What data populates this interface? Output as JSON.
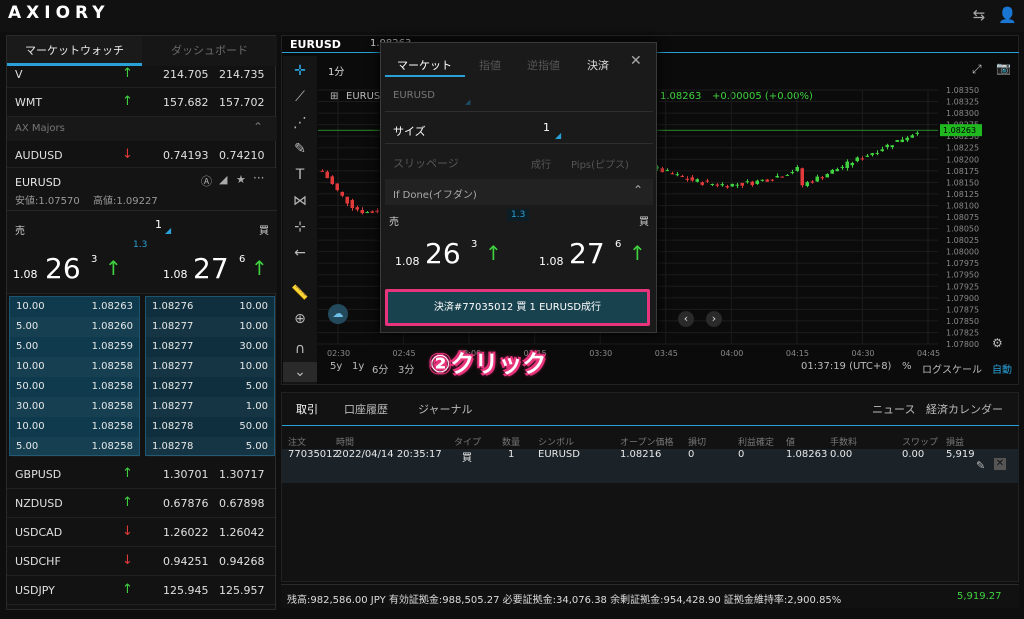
{
  "app": {
    "logo": "AXIORY"
  },
  "left": {
    "tabs": [
      "マーケットウォッチ",
      "ダッシュボード"
    ],
    "rows_top": [
      {
        "sym": "V",
        "bid": "214.705",
        "ask": "214.735",
        "dir": "up"
      },
      {
        "sym": "WMT",
        "bid": "157.682",
        "ask": "157.702",
        "dir": "up"
      }
    ],
    "section": "AX Majors",
    "audusd": {
      "sym": "AUDUSD",
      "bid": "0.74193",
      "ask": "0.74210",
      "dir": "down"
    },
    "eurusd": {
      "sym": "EURUSD",
      "low": "安値:1.07570",
      "high": "高値:1.09227",
      "sell_label": "売",
      "buy_label": "買",
      "qty": "1",
      "spread": "1.3",
      "sell_prefix": "1.08",
      "sell_big": "26",
      "sell_sup": "3",
      "buy_prefix": "1.08",
      "buy_big": "27",
      "buy_sup": "6"
    },
    "depth_sell": [
      [
        "10.00",
        "1.08263"
      ],
      [
        "5.00",
        "1.08260"
      ],
      [
        "5.00",
        "1.08259"
      ],
      [
        "10.00",
        "1.08258"
      ],
      [
        "50.00",
        "1.08258"
      ],
      [
        "30.00",
        "1.08258"
      ],
      [
        "10.00",
        "1.08258"
      ],
      [
        "5.00",
        "1.08258"
      ]
    ],
    "depth_buy": [
      [
        "1.08276",
        "10.00"
      ],
      [
        "1.08277",
        "10.00"
      ],
      [
        "1.08277",
        "30.00"
      ],
      [
        "1.08277",
        "10.00"
      ],
      [
        "1.08277",
        "5.00"
      ],
      [
        "1.08277",
        "1.00"
      ],
      [
        "1.08278",
        "50.00"
      ],
      [
        "1.08278",
        "5.00"
      ]
    ],
    "rows_bottom": [
      {
        "sym": "GBPUSD",
        "bid": "1.30701",
        "ask": "1.30717",
        "dir": "up"
      },
      {
        "sym": "NZDUSD",
        "bid": "0.67876",
        "ask": "0.67898",
        "dir": "up"
      },
      {
        "sym": "USDCAD",
        "bid": "1.26022",
        "ask": "1.26042",
        "dir": "down"
      },
      {
        "sym": "USDCHF",
        "bid": "0.94251",
        "ask": "0.94268",
        "dir": "down"
      },
      {
        "sym": "USDJPY",
        "bid": "125.945",
        "ask": "125.957",
        "dir": "up"
      }
    ]
  },
  "chart": {
    "tab": "EURUSD",
    "tab_price": "1.08263",
    "timeframe": "1分",
    "symbol": "EURUSD",
    "last": "1.08263",
    "change": "+0.00005 (+0.00%)",
    "price_tag": "1.08263",
    "yticks": [
      "1.08350",
      "1.08325",
      "1.08300",
      "1.08275",
      "1.08250",
      "1.08225",
      "1.08200",
      "1.08175",
      "1.08150",
      "1.08125",
      "1.08100",
      "1.08075",
      "1.08050",
      "1.08025",
      "1.08000",
      "1.07975",
      "1.07950",
      "1.07925",
      "1.07900",
      "1.07875",
      "1.07850",
      "1.07825",
      "1.07800"
    ],
    "xticks": [
      "02:30",
      "02:45",
      "03:00",
      "03:15",
      "03:30",
      "03:45",
      "04:00",
      "04:15",
      "04:30",
      "04:45"
    ],
    "ranges": [
      "5y",
      "1y",
      "6分",
      "3分"
    ],
    "clock": "01:37:19 (UTC+8)",
    "pct": "%",
    "logscale": "ログスケール",
    "auto": "自動"
  },
  "dialog": {
    "tabs": [
      "マーケット",
      "指値",
      "逆指値",
      "決済"
    ],
    "symbol": "EURUSD",
    "size_label": "サイズ",
    "size_value": "1",
    "slip_label": "スリッページ",
    "slip_mode": "成行",
    "slip_unit": "Pips(ピプス)",
    "ifdone": "If Done(イフダン)",
    "sell_label": "売",
    "buy_label": "買",
    "spread": "1.3",
    "sell_prefix": "1.08",
    "sell_big": "26",
    "sell_sup": "3",
    "buy_prefix": "1.08",
    "buy_big": "27",
    "buy_sup": "6",
    "exec_label": "決済#77035012 買 1 EURUSD成行"
  },
  "annotation": "②クリック",
  "bottom": {
    "tabs": [
      "取引",
      "口座履歴",
      "ジャーナル"
    ],
    "right_tabs": [
      "ニュース",
      "経済カレンダー"
    ],
    "headers": [
      "注文",
      "時間",
      "タイプ",
      "数量",
      "シンボル",
      "オープン価格",
      "損切",
      "利益確定",
      "値",
      "手数料",
      "スワップ",
      "損益"
    ],
    "row": [
      "77035012",
      "2022/04/14 20:35:17",
      "買",
      "1",
      "EURUSD",
      "1.08216",
      "0",
      "0",
      "1.08263",
      "0.00",
      "0.00",
      "5,919"
    ]
  },
  "status": {
    "text": "残高:982,586.00 JPY   有効証拠金:988,505.27   必要証拠金:34,076.38   余剰証拠金:954,428.90   証拠金維持率:2,900.85%",
    "pl": "5,919.27"
  }
}
